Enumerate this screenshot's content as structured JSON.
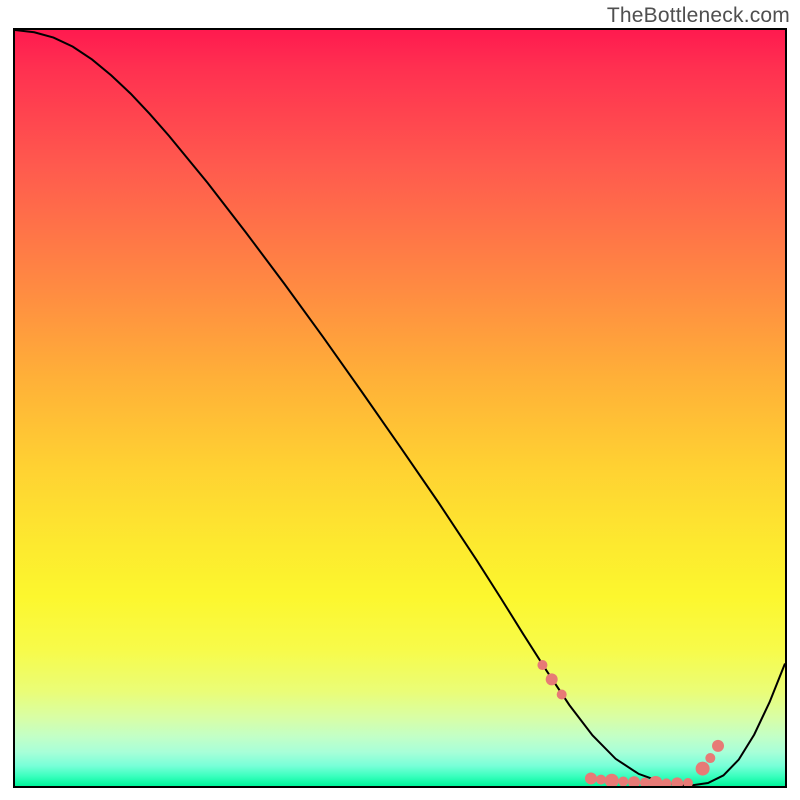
{
  "watermark": "TheBottleneck.com",
  "chart_data": {
    "type": "line",
    "title": "",
    "xlabel": "",
    "ylabel": "",
    "xlim": [
      0,
      100
    ],
    "ylim": [
      0,
      100
    ],
    "grid": false,
    "legend": false,
    "background_gradient": {
      "direction": "vertical",
      "stops": [
        {
          "pos": 0.0,
          "color": "#ff1a4f"
        },
        {
          "pos": 0.05,
          "color": "#ff3050"
        },
        {
          "pos": 0.18,
          "color": "#ff5a4e"
        },
        {
          "pos": 0.34,
          "color": "#ff8a42"
        },
        {
          "pos": 0.46,
          "color": "#ffb038"
        },
        {
          "pos": 0.58,
          "color": "#ffd232"
        },
        {
          "pos": 0.68,
          "color": "#fde92f"
        },
        {
          "pos": 0.75,
          "color": "#fcf72e"
        },
        {
          "pos": 0.82,
          "color": "#f7fb4a"
        },
        {
          "pos": 0.875,
          "color": "#eafd77"
        },
        {
          "pos": 0.91,
          "color": "#d8fea6"
        },
        {
          "pos": 0.935,
          "color": "#c2ffc7"
        },
        {
          "pos": 0.955,
          "color": "#a8ffd8"
        },
        {
          "pos": 0.973,
          "color": "#79ffd8"
        },
        {
          "pos": 0.987,
          "color": "#3affbe"
        },
        {
          "pos": 1.0,
          "color": "#00f59a"
        }
      ]
    },
    "series": [
      {
        "name": "bottleneck-curve",
        "color": "#000000",
        "stroke_width": 2,
        "x": [
          0.0,
          2.5,
          5.0,
          7.5,
          10.0,
          12.5,
          15.0,
          17.5,
          20.0,
          25.0,
          30.0,
          35.0,
          40.0,
          45.0,
          50.0,
          55.0,
          60.0,
          63.0,
          66.0,
          69.0,
          72.0,
          75.0,
          78.0,
          81.0,
          84.0,
          86.0,
          88.0,
          90.0,
          92.0,
          94.0,
          96.0,
          98.0,
          100.0
        ],
        "y": [
          100.0,
          99.7,
          99.0,
          97.8,
          96.1,
          94.0,
          91.6,
          88.9,
          86.0,
          79.8,
          73.2,
          66.4,
          59.4,
          52.2,
          44.9,
          37.5,
          29.8,
          25.0,
          20.1,
          15.3,
          10.7,
          6.7,
          3.6,
          1.6,
          0.5,
          0.15,
          0.1,
          0.4,
          1.4,
          3.5,
          6.8,
          11.1,
          16.2
        ]
      }
    ],
    "markers": {
      "name": "highlight-dots",
      "color": "#e77a76",
      "radius_px_avg": 6,
      "points": [
        {
          "x": 68.5,
          "y": 16.0,
          "r": 5
        },
        {
          "x": 69.7,
          "y": 14.1,
          "r": 6
        },
        {
          "x": 71.0,
          "y": 12.1,
          "r": 5
        },
        {
          "x": 74.8,
          "y": 1.0,
          "r": 6
        },
        {
          "x": 76.1,
          "y": 0.85,
          "r": 5
        },
        {
          "x": 77.5,
          "y": 0.7,
          "r": 7
        },
        {
          "x": 79.0,
          "y": 0.6,
          "r": 5
        },
        {
          "x": 80.4,
          "y": 0.5,
          "r": 6
        },
        {
          "x": 81.8,
          "y": 0.45,
          "r": 5
        },
        {
          "x": 83.2,
          "y": 0.4,
          "r": 7
        },
        {
          "x": 84.6,
          "y": 0.35,
          "r": 5
        },
        {
          "x": 86.0,
          "y": 0.35,
          "r": 6
        },
        {
          "x": 87.4,
          "y": 0.4,
          "r": 5
        },
        {
          "x": 89.3,
          "y": 2.3,
          "r": 7
        },
        {
          "x": 90.3,
          "y": 3.7,
          "r": 5
        },
        {
          "x": 91.3,
          "y": 5.3,
          "r": 6
        }
      ]
    }
  }
}
